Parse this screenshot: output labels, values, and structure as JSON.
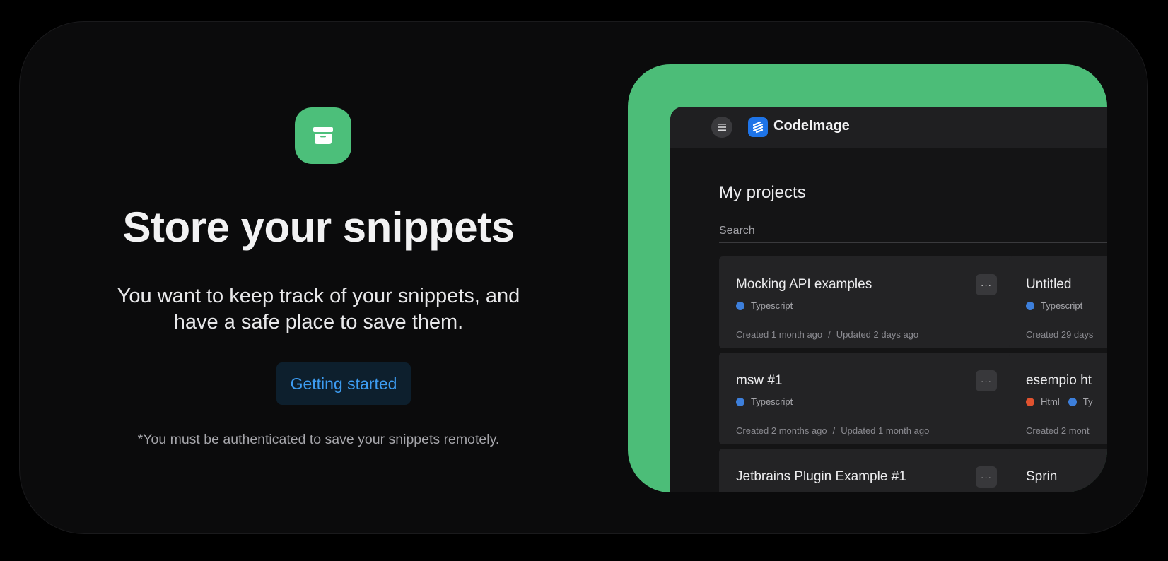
{
  "hero": {
    "icon": "archive-box-icon",
    "title": "Store your snippets",
    "subtitle_line1": "You want to keep track of your snippets, and",
    "subtitle_line2": "have a safe place to save them.",
    "cta_label": "Getting started",
    "note": "*You must be authenticated to save your snippets remotely."
  },
  "app": {
    "brand": "CodeImage",
    "page_title": "My projects",
    "search_placeholder": "Search",
    "more_label": "···",
    "projects": [
      {
        "name": "Mocking API examples",
        "langs": [
          {
            "name": "Typescript",
            "color": "#3d7fdb"
          }
        ],
        "created": "Created 1 month ago",
        "updated": "Updated 2 days ago"
      },
      {
        "name": "Untitled",
        "langs": [
          {
            "name": "Typescript",
            "color": "#3d7fdb"
          }
        ],
        "created": "Created 29 days",
        "updated": ""
      },
      {
        "name": "msw #1",
        "langs": [
          {
            "name": "Typescript",
            "color": "#3d7fdb"
          }
        ],
        "created": "Created 2 months ago",
        "updated": "Updated 1 month ago"
      },
      {
        "name": "esempio ht",
        "langs": [
          {
            "name": "Html",
            "color": "#e0522f"
          },
          {
            "name": "Ty",
            "color": "#3d7fdb"
          }
        ],
        "created": "Created 2 mont",
        "updated": ""
      },
      {
        "name": "Jetbrains Plugin Example #1",
        "langs": [],
        "created": "",
        "updated": ""
      },
      {
        "name": "Sprin",
        "langs": [],
        "created": "",
        "updated": ""
      }
    ]
  },
  "colors": {
    "accent_green": "#4cbd78",
    "link_blue": "#3d9cf1",
    "brand_blue": "#1e74e8"
  }
}
